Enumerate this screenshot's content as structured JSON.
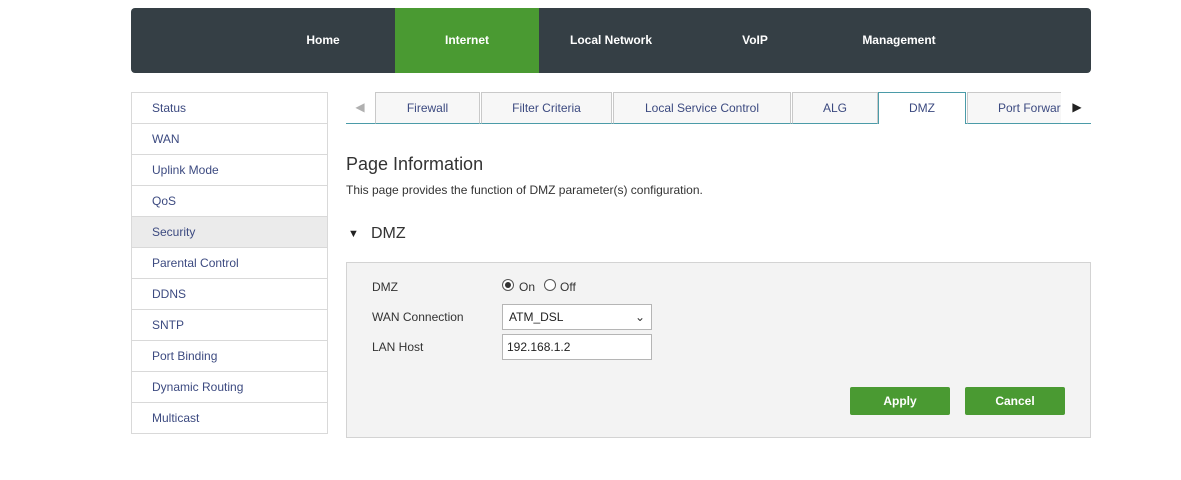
{
  "topnav": {
    "items": [
      {
        "label": "Home"
      },
      {
        "label": "Internet"
      },
      {
        "label": "Local Network"
      },
      {
        "label": "VoIP"
      },
      {
        "label": "Management"
      }
    ],
    "active_color": "#4a9a32",
    "bg_color": "#353f45"
  },
  "sidebar": {
    "items": [
      {
        "label": "Status"
      },
      {
        "label": "WAN"
      },
      {
        "label": "Uplink Mode"
      },
      {
        "label": "QoS"
      },
      {
        "label": "Security"
      },
      {
        "label": "Parental Control"
      },
      {
        "label": "DDNS"
      },
      {
        "label": "SNTP"
      },
      {
        "label": "Port Binding"
      },
      {
        "label": "Dynamic Routing"
      },
      {
        "label": "Multicast"
      }
    ],
    "active": "Security"
  },
  "tabs": {
    "prev_icon": "left-triangle-icon",
    "next_icon": "right-triangle-icon",
    "items": [
      {
        "label": "Firewall"
      },
      {
        "label": "Filter Criteria"
      },
      {
        "label": "Local Service Control"
      },
      {
        "label": "ALG"
      },
      {
        "label": "DMZ"
      },
      {
        "label": "Port Forwarding"
      }
    ],
    "active": "DMZ"
  },
  "page": {
    "title": "Page Information",
    "description": "This page provides the function of DMZ parameter(s) configuration."
  },
  "section": {
    "title": "DMZ",
    "icon": "collapse-triangle-icon"
  },
  "form": {
    "dmz_label": "DMZ",
    "dmz_on_label": "On",
    "dmz_off_label": "Off",
    "dmz_value": "On",
    "wan_label": "WAN Connection",
    "wan_value": "ATM_DSL",
    "lan_label": "LAN Host",
    "lan_value": "192.168.1.2"
  },
  "buttons": {
    "apply": "Apply",
    "cancel": "Cancel"
  }
}
